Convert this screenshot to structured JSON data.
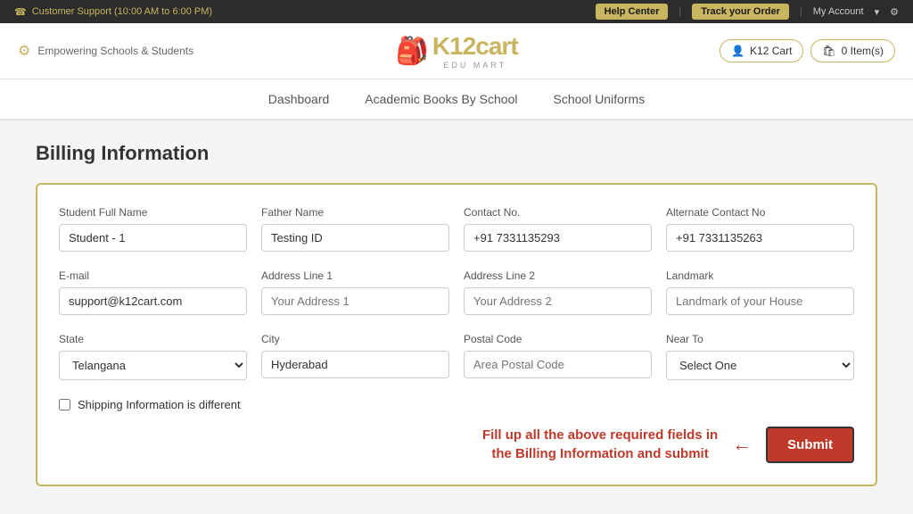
{
  "topbar": {
    "support": "Customer Support (10:00 AM to 6:00 PM)",
    "help_center": "Help Center",
    "track_order": "Track your Order",
    "my_account": "My Account",
    "phone_icon": "☎"
  },
  "header": {
    "tagline": "Empowering Schools & Students",
    "logo_k12": "K12cart",
    "logo_edu": "EDU MART",
    "k12cart_btn": "K12 Cart",
    "items_btn": "0 Item(s)"
  },
  "nav": {
    "items": [
      {
        "label": "Dashboard",
        "active": false
      },
      {
        "label": "Academic Books By School",
        "active": false
      },
      {
        "label": "School Uniforms",
        "active": false
      }
    ]
  },
  "page": {
    "title": "Billing Information"
  },
  "form": {
    "row1": {
      "student_name_label": "Student Full Name",
      "student_name_value": "Student - 1",
      "father_name_label": "Father Name",
      "father_name_value": "Testing ID",
      "contact_label": "Contact No.",
      "contact_value": "+91 7331135293",
      "alt_contact_label": "Alternate Contact No",
      "alt_contact_value": "+91 7331135263"
    },
    "row2": {
      "email_label": "E-mail",
      "email_value": "support@k12cart.com",
      "addr1_label": "Address Line 1",
      "addr1_placeholder": "Your Address 1",
      "addr2_label": "Address Line 2",
      "addr2_placeholder": "Your Address 2",
      "landmark_label": "Landmark",
      "landmark_placeholder": "Landmark of your House"
    },
    "row3": {
      "state_label": "State",
      "state_value": "Telangana",
      "city_label": "City",
      "city_value": "Hyderabad",
      "postal_label": "Postal Code",
      "postal_placeholder": "Area Postal Code",
      "nearto_label": "Near To",
      "nearto_placeholder": "Select One"
    },
    "checkbox_label": "Shipping Information is different",
    "submit_hint_line1": "Fill up all the above required fields  in",
    "submit_hint_line2": "the Billing Information and submit",
    "submit_label": "Submit"
  }
}
